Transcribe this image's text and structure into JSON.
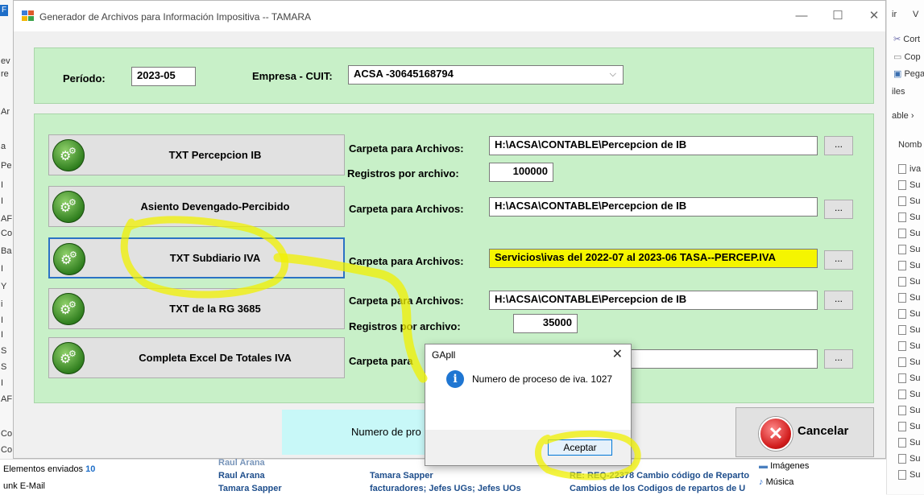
{
  "window": {
    "title": "Generador de Archivos para Información Impositiva  --  TAMARA",
    "minimize": "—",
    "maximize": "☐",
    "close": "✕"
  },
  "header": {
    "periodo_label": "Período:",
    "periodo_value": "2023-05",
    "empresa_label": "Empresa - CUIT:",
    "empresa_value": "ACSA  -30645168794"
  },
  "rows": [
    {
      "button": "TXT Percepcion IB",
      "carpeta_label": "Carpeta para Archivos:",
      "carpeta_value": "H:\\ACSA\\CONTABLE\\Percepcion de IB",
      "registros_label": "Registros por archivo:",
      "registros_value": "100000"
    },
    {
      "button": "Asiento Devengado-Percibido",
      "carpeta_label": "Carpeta para Archivos:",
      "carpeta_value": "H:\\ACSA\\CONTABLE\\Percepcion de IB"
    },
    {
      "button": "TXT Subdiario IVA",
      "carpeta_label": "Carpeta para Archivos:",
      "carpeta_value": "Servicios\\ivas del 2022-07 al 2023-06   TASA--PERCEP.IVA"
    },
    {
      "button": "TXT de la RG 3685",
      "carpeta_label": "Carpeta para Archivos:",
      "carpeta_value": "H:\\ACSA\\CONTABLE\\Percepcion de IB",
      "registros_label": "Registros por archivo:",
      "registros_value": "35000"
    },
    {
      "button": "Completa Excel De Totales IVA",
      "carpeta_label": "Carpeta para",
      "carpeta_value": ""
    }
  ],
  "browse_label": "...",
  "status_text": "Numero de pro",
  "cancel_label": "Cancelar",
  "dialog": {
    "title": "GApll",
    "close": "✕",
    "icon_text": "i",
    "message": "Numero de proceso de iva. 1027",
    "ok_label": "Aceptar"
  },
  "background": {
    "left_fragments": [
      "F",
      "ev",
      "re",
      "Ar",
      "a",
      "Pe",
      "I",
      "I",
      "AF",
      "Co",
      "Ba",
      "I",
      "Y",
      "i",
      "I",
      "I",
      "S",
      "S",
      "I",
      "AF",
      "Co",
      "Co"
    ],
    "right_menu": [
      "ir",
      "V",
      "Cort",
      "Cop",
      "Pega",
      "iles",
      "able ›",
      "Nomb"
    ],
    "right_files": [
      "iva",
      "Su",
      "Su",
      "Su",
      "Su",
      "Su",
      "Su",
      "Su",
      "Su",
      "Su",
      "Su",
      "Su",
      "Su",
      "Su",
      "Su",
      "Su",
      "Su",
      "Su",
      "Su",
      "Su"
    ],
    "mail": {
      "folder1": "Elementos enviados",
      "folder1_count": "10",
      "folder2": "unk E-Mail",
      "rows": [
        {
          "from": "Raul Arana",
          "to": "Tamara Sapper",
          "subject": "RE: REQ-22378 Cambio código de Reparto"
        },
        {
          "from": "Tamara Sapper",
          "to": "facturadores; Jefes UGs; Jefes UOs",
          "subject": "Cambios de los Codigos de repartos de U"
        }
      ],
      "partial_top": "Raul Arana",
      "places": [
        "Imágenes",
        "Música"
      ]
    }
  },
  "colors": {
    "panel_green": "#c8f0c8",
    "highlight_yellow": "#f5f500",
    "focus_blue": "#2b72c4",
    "status_cyan": "#c8f8f8"
  }
}
